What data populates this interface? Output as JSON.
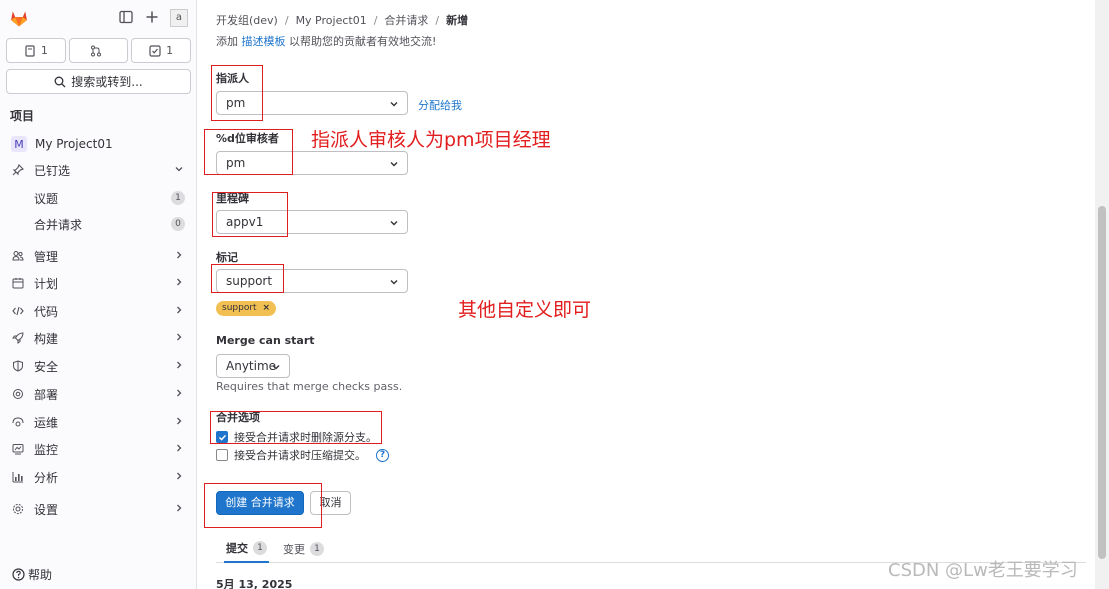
{
  "sidebar": {
    "avatar_alt": "a",
    "counters": [
      {
        "icon": "issues-icon",
        "count": "1"
      },
      {
        "icon": "merge-request-icon",
        "count": ""
      },
      {
        "icon": "todo-icon",
        "count": "1"
      }
    ],
    "search_label": "搜索或转到...",
    "section_label": "项目",
    "project": {
      "initial": "M",
      "name": "My Project01"
    },
    "pinned": {
      "label": "已钉选",
      "items": [
        {
          "label": "议题",
          "count": "1"
        },
        {
          "label": "合并请求",
          "count": "0"
        }
      ]
    },
    "items": [
      {
        "label": "管理",
        "icon": "users-icon"
      },
      {
        "label": "计划",
        "icon": "calendar-icon"
      },
      {
        "label": "代码",
        "icon": "code-icon"
      },
      {
        "label": "构建",
        "icon": "rocket-icon"
      },
      {
        "label": "安全",
        "icon": "shield-icon"
      },
      {
        "label": "部署",
        "icon": "deployments-icon"
      },
      {
        "label": "运维",
        "icon": "monitor-icon"
      },
      {
        "label": "监控",
        "icon": "chart-icon"
      },
      {
        "label": "分析",
        "icon": "analytics-icon"
      },
      {
        "label": "设置",
        "icon": "settings-icon"
      }
    ],
    "help_label": "帮助"
  },
  "breadcrumb": [
    "开发组(dev)",
    "My Project01",
    "合并请求",
    "新增"
  ],
  "hint": {
    "before": "添加 ",
    "link": "描述模板",
    "after": " 以帮助您的贡献者有效地交流!"
  },
  "form": {
    "assignee": {
      "label": "指派人",
      "value": "pm",
      "link": "分配给我"
    },
    "reviewer": {
      "label": "%d位审核者",
      "value": "pm"
    },
    "milestone": {
      "label": "里程碑",
      "value": "appv1"
    },
    "labels": {
      "label": "标记",
      "value": "support",
      "chip": "support"
    },
    "merge_start": {
      "label": "Merge can start",
      "value": "Anytime",
      "help": "Requires that merge checks pass."
    },
    "merge_options": {
      "label": "合并选项",
      "options": [
        {
          "label": "接受合并请求时删除源分支。",
          "checked": true
        },
        {
          "label": "接受合并请求时压缩提交。",
          "checked": false
        }
      ]
    },
    "submit_label": "创建 合并请求",
    "cancel_label": "取消"
  },
  "tabs": [
    {
      "label": "提交",
      "count": "1",
      "active": true
    },
    {
      "label": "变更",
      "count": "1",
      "active": false
    }
  ],
  "date": "5月 13, 2025",
  "annotations": {
    "note1": "指派人审核人为pm项目经理",
    "note2": "其他自定义即可",
    "color": "#e21d1d"
  },
  "watermark": "CSDN @Lw老王要学习"
}
